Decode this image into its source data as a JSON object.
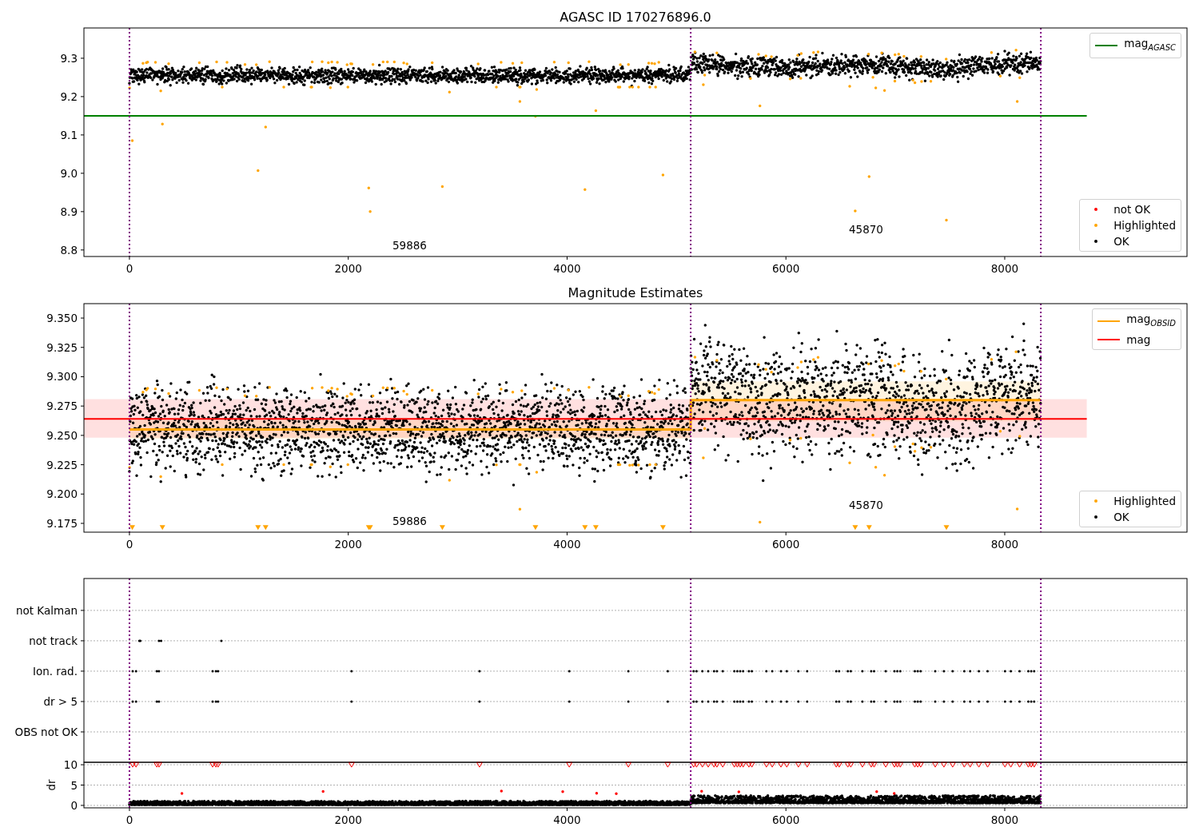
{
  "figure": {
    "panels": [
      {
        "kind": "magnitude",
        "title": "AGASC ID 170276896.0",
        "chart_data": {
          "type": "line",
          "xlim": [
            -416,
            9666
          ],
          "ylim": [
            8.783,
            9.379
          ],
          "xticks": [
            {
              "value": 0,
              "label": "0"
            },
            {
              "value": 2000,
              "label": "2000"
            },
            {
              "value": 4000,
              "label": "4000"
            },
            {
              "value": 6000,
              "label": "6000"
            },
            {
              "value": 8000,
              "label": "8000"
            }
          ],
          "yticks": [
            {
              "value": 8.8,
              "label": "8.8"
            },
            {
              "value": 8.9,
              "label": "8.9"
            },
            {
              "value": 9.0,
              "label": "9.0"
            },
            {
              "value": 9.1,
              "label": "9.1"
            },
            {
              "value": 9.2,
              "label": "9.2"
            },
            {
              "value": 9.3,
              "label": "9.3"
            }
          ],
          "series": [
            {
              "name": "mag$_{AGASC}$",
              "color": "#008000",
              "x": [
                -416,
                8750
              ],
              "values": [
                9.15,
                9.15
              ]
            }
          ],
          "ref_lines": [
            {
              "axis": "x",
              "value": 0,
              "color": "#800080"
            },
            {
              "axis": "x",
              "value": 5130,
              "color": "#800080"
            },
            {
              "axis": "x",
              "value": 8330,
              "color": "#800080"
            }
          ],
          "annotations": [
            "59886",
            "45870"
          ]
        },
        "marker_legend": [
          {
            "label": "not OK",
            "color": "#ff0000"
          },
          {
            "label": "Highlighted",
            "color": "#ffa500"
          },
          {
            "label": "OK",
            "color": "#000000"
          }
        ]
      },
      {
        "kind": "estimates",
        "title": "Magnitude Estimates",
        "chart_data": {
          "type": "line",
          "xlim": [
            -416,
            9666
          ],
          "ylim": [
            9.1675,
            9.3623
          ],
          "xticks": [
            {
              "value": 0,
              "label": "0"
            },
            {
              "value": 2000,
              "label": "2000"
            },
            {
              "value": 4000,
              "label": "4000"
            },
            {
              "value": 6000,
              "label": "6000"
            },
            {
              "value": 8000,
              "label": "8000"
            }
          ],
          "yticks": [
            {
              "value": 9.175,
              "label": "9.175"
            },
            {
              "value": 9.2,
              "label": "9.200"
            },
            {
              "value": 9.225,
              "label": "9.225"
            },
            {
              "value": 9.25,
              "label": "9.250"
            },
            {
              "value": 9.275,
              "label": "9.275"
            },
            {
              "value": 9.3,
              "label": "9.300"
            },
            {
              "value": 9.325,
              "label": "9.325"
            },
            {
              "value": 9.35,
              "label": "9.350"
            }
          ],
          "series": [
            {
              "name": "mag$_{OBSID}$",
              "color": "#ffa500",
              "x": [
                0,
                5129,
                5131,
                8330
              ],
              "values": [
                9.255,
                9.255,
                9.28,
                9.28
              ],
              "lower": [
                9.247,
                9.247,
                9.262,
                9.262
              ],
              "upper": [
                9.263,
                9.263,
                9.296,
                9.296
              ]
            },
            {
              "name": "mag",
              "color": "#ff0000",
              "x": [
                -416,
                8750
              ],
              "values": [
                9.264,
                9.264
              ],
              "lower": [
                9.248,
                9.248
              ],
              "upper": [
                9.281,
                9.281
              ]
            }
          ],
          "ref_lines": [
            {
              "axis": "x",
              "value": 0,
              "color": "#800080"
            },
            {
              "axis": "x",
              "value": 5130,
              "color": "#800080"
            },
            {
              "axis": "x",
              "value": 8330,
              "color": "#800080"
            }
          ],
          "annotations": [
            "59886",
            "45870"
          ]
        },
        "marker_legend": [
          {
            "label": "Highlighted",
            "color": "#ffa500"
          },
          {
            "label": "OK",
            "color": "#000000"
          }
        ]
      },
      {
        "kind": "flags",
        "chart_data": {
          "type": "scatter",
          "xlim": [
            -416,
            9666
          ],
          "grid": true,
          "orientation": "horizontal",
          "categories": [
            "not Kalman",
            "not track",
            "Ion. rad.",
            "dr > 5",
            "OBS not OK"
          ],
          "ref_lines": [
            {
              "axis": "x",
              "value": 0,
              "color": "#800080"
            },
            {
              "axis": "x",
              "value": 5130,
              "color": "#800080"
            },
            {
              "axis": "x",
              "value": 8330,
              "color": "#800080"
            }
          ]
        }
      },
      {
        "kind": "dr",
        "chart_data": {
          "type": "scatter",
          "ylabel": "dr",
          "grid": true,
          "xlim": [
            -416,
            9666
          ],
          "ylim": [
            -0.6,
            10.6
          ],
          "xticks": [
            {
              "value": 0,
              "label": "0"
            },
            {
              "value": 2000,
              "label": "2000"
            },
            {
              "value": 4000,
              "label": "4000"
            },
            {
              "value": 6000,
              "label": "6000"
            },
            {
              "value": 8000,
              "label": "8000"
            }
          ],
          "yticks": [
            {
              "value": 0,
              "label": "0"
            },
            {
              "value": 5,
              "label": "5"
            },
            {
              "value": 10,
              "label": "10"
            }
          ],
          "ref_lines": [
            {
              "axis": "x",
              "value": 0,
              "color": "#800080"
            },
            {
              "axis": "x",
              "value": 5130,
              "color": "#800080"
            },
            {
              "axis": "x",
              "value": 8330,
              "color": "#800080"
            }
          ]
        }
      }
    ]
  }
}
